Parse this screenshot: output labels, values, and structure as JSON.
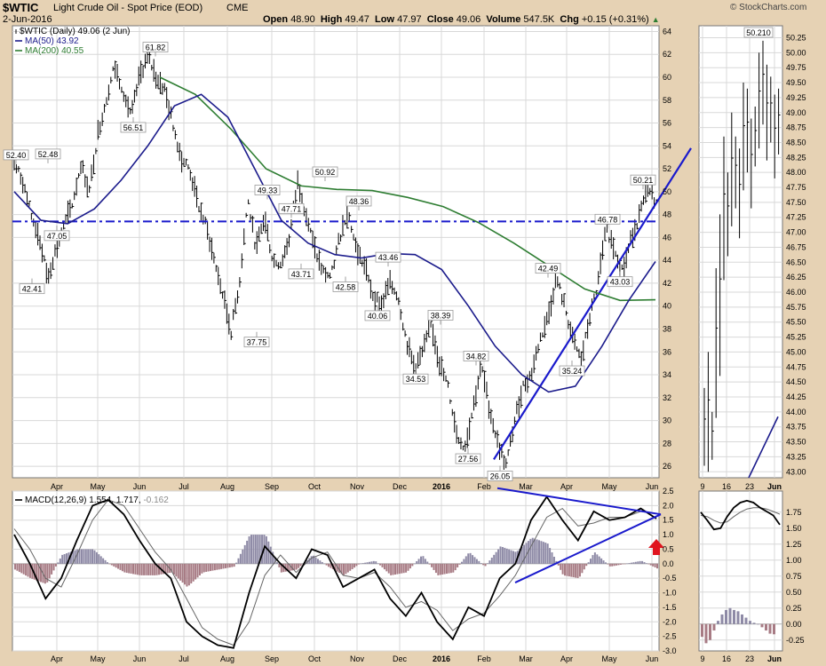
{
  "header": {
    "symbol": "$WTIC",
    "description": "Light Crude Oil - Spot Price (EOD)",
    "exchange": "CME",
    "date": "2-Jun-2016",
    "watermark": "© StockCharts.com",
    "open_label": "Open",
    "open": "48.90",
    "high_label": "High",
    "high": "49.47",
    "low_label": "Low",
    "low": "47.97",
    "close_label": "Close",
    "close": "49.06",
    "volume_label": "Volume",
    "volume": "547.5K",
    "chg_label": "Chg",
    "chg": "+0.15 (+0.31%)"
  },
  "chart_data": [
    {
      "type": "line",
      "title": "$WTIC (Daily) 49.06 (2 Jun)",
      "legend": [
        {
          "name": "$WTIC (Daily) 49.06 (2 Jun)",
          "color": "#000000"
        },
        {
          "name": "MA(50) 43.92",
          "color": "#1c1c8c"
        },
        {
          "name": "MA(200) 40.55",
          "color": "#2e7d32"
        }
      ],
      "x_ticks": [
        "Apr",
        "May",
        "Jun",
        "Jul",
        "Aug",
        "Sep",
        "Oct",
        "Nov",
        "Dec",
        "2016",
        "Feb",
        "Mar",
        "Apr",
        "May",
        "Jun"
      ],
      "y_ticks": [
        26,
        28,
        30,
        32,
        34,
        36,
        38,
        40,
        42,
        44,
        46,
        48,
        50,
        52,
        54,
        56,
        58,
        60,
        62,
        64
      ],
      "ylim": [
        25,
        64.5
      ],
      "price_path": [
        52.4,
        51,
        48,
        46,
        42.41,
        45,
        47.05,
        49,
        52.48,
        50,
        55,
        58,
        61,
        59,
        56.51,
        60,
        61.82,
        60,
        59,
        56,
        53,
        52,
        49,
        47,
        44,
        41,
        37.75,
        42,
        49.33,
        45,
        47.71,
        44,
        43.71,
        46,
        50.92,
        48,
        45,
        43,
        42.58,
        46,
        48.36,
        45,
        43.46,
        41,
        40.06,
        42,
        41,
        37,
        34.53,
        36,
        38.39,
        35,
        33,
        29,
        27.56,
        31,
        34.82,
        31,
        28,
        26.05,
        30,
        33,
        34,
        37,
        39,
        42.49,
        40,
        37,
        35.24,
        39,
        42,
        46.78,
        45,
        43.03,
        46,
        48,
        50.21,
        49.06
      ],
      "swing_labels": [
        {
          "text": "52.40",
          "value": 52.4
        },
        {
          "text": "42.41",
          "value": 42.41
        },
        {
          "text": "47.05",
          "value": 47.05
        },
        {
          "text": "52.48",
          "value": 52.48
        },
        {
          "text": "56.51",
          "value": 56.51
        },
        {
          "text": "61.82",
          "value": 61.82
        },
        {
          "text": "37.75",
          "value": 37.75
        },
        {
          "text": "49.33",
          "value": 49.33
        },
        {
          "text": "47.71",
          "value": 47.71
        },
        {
          "text": "43.71",
          "value": 43.71
        },
        {
          "text": "50.92",
          "value": 50.92
        },
        {
          "text": "42.58",
          "value": 42.58
        },
        {
          "text": "48.36",
          "value": 48.36
        },
        {
          "text": "43.46",
          "value": 43.46
        },
        {
          "text": "40.06",
          "value": 40.06
        },
        {
          "text": "34.53",
          "value": 34.53
        },
        {
          "text": "38.39",
          "value": 38.39
        },
        {
          "text": "27.56",
          "value": 27.56
        },
        {
          "text": "34.82",
          "value": 34.82
        },
        {
          "text": "26.05",
          "value": 26.05
        },
        {
          "text": "35.24",
          "value": 35.24
        },
        {
          "text": "42.49",
          "value": 42.49
        },
        {
          "text": "46.78",
          "value": 46.78
        },
        {
          "text": "43.03",
          "value": 43.03
        },
        {
          "text": "50.21",
          "value": 50.21
        }
      ],
      "ma50": [
        50,
        47.5,
        47.2,
        48.5,
        51,
        54,
        57.5,
        58.5,
        56.5,
        52,
        47.5,
        45.5,
        44.5,
        44.2,
        44.6,
        44.5,
        43.2,
        40,
        36.5,
        34,
        32.5,
        33,
        36.5,
        40.5,
        43.9
      ],
      "ma200": [
        60,
        58.5,
        55.5,
        52,
        50.5,
        50.2,
        50.1,
        49.5,
        48.7,
        47.3,
        45.5,
        43.5,
        41.5,
        40.5,
        40.55
      ],
      "horizontal_level": 47.4,
      "trendline": {
        "from": 26.6,
        "to": 53.8
      },
      "zoom_panel": {
        "x_ticks": [
          "9",
          "16",
          "23",
          "Jun"
        ],
        "y_ticks": [
          43.0,
          43.25,
          43.5,
          43.75,
          44.0,
          44.25,
          44.5,
          44.75,
          45.0,
          45.25,
          45.5,
          45.75,
          46.0,
          46.25,
          46.5,
          46.75,
          47.0,
          47.25,
          47.5,
          47.75,
          48.0,
          48.25,
          48.5,
          48.75,
          49.0,
          49.25,
          49.5,
          49.75,
          50.0,
          50.25
        ],
        "ylim": [
          42.9,
          50.45
        ],
        "high_label": "50.210"
      }
    },
    {
      "type": "line",
      "title": "MACD(12,26,9) 1.554, 1.717, -0.162",
      "legend_title": "MACD(12,26,9)",
      "legend_values": "1.554, 1.717, -0.162",
      "legend_colors": [
        "#000000",
        "#000000",
        "#8a8a8a"
      ],
      "ylim": [
        -3.0,
        2.5
      ],
      "y_ticks": [
        "2.5",
        "2.0",
        "1.5",
        "1.0",
        "0.5",
        "0.0",
        "-0.5",
        "-1.0",
        "-1.5",
        "-2.0",
        "-2.5",
        "-3.0"
      ],
      "x_ticks": [
        "Apr",
        "May",
        "Jun",
        "Jul",
        "Aug",
        "Sep",
        "Oct",
        "Nov",
        "Dec",
        "2016",
        "Feb",
        "Mar",
        "Apr",
        "May",
        "Jun"
      ],
      "macd": [
        1.0,
        0,
        -1.2,
        -0.5,
        0.8,
        2.0,
        2.2,
        1.7,
        0.8,
        0.0,
        -0.5,
        -2.0,
        -2.5,
        -2.8,
        -2.9,
        -1.0,
        0.6,
        0.0,
        -0.5,
        0.5,
        0.3,
        -0.8,
        -0.5,
        -0.2,
        -1.2,
        -1.8,
        -1.0,
        -2.0,
        -2.6,
        -1.5,
        -1.8,
        -0.5,
        0.0,
        1.5,
        2.3,
        1.5,
        0.8,
        1.8,
        1.5,
        1.6,
        1.9,
        1.554
      ],
      "signal": [
        1.2,
        0.5,
        -0.5,
        -0.8,
        0.3,
        1.5,
        2.2,
        2.0,
        1.2,
        0.4,
        -0.2,
        -1.2,
        -2.2,
        -2.6,
        -2.8,
        -2.0,
        -0.4,
        0.3,
        -0.3,
        0.2,
        0.4,
        -0.4,
        -0.5,
        -0.3,
        -0.8,
        -1.5,
        -1.3,
        -1.6,
        -2.3,
        -1.9,
        -1.7,
        -1.1,
        -0.4,
        0.6,
        1.6,
        1.9,
        1.3,
        1.4,
        1.6,
        1.6,
        1.8,
        1.717
      ],
      "histogram": [
        -0.2,
        -0.5,
        -0.7,
        0.3,
        0.5,
        0.5,
        0.0,
        -0.3,
        -0.4,
        -0.4,
        -0.3,
        -0.8,
        -0.3,
        -0.2,
        -0.1,
        1.0,
        1.0,
        -0.3,
        -0.2,
        0.3,
        -0.1,
        -0.4,
        0.0,
        0.1,
        -0.4,
        -0.3,
        0.3,
        -0.4,
        -0.3,
        0.4,
        -0.1,
        0.6,
        0.4,
        0.9,
        0.7,
        -0.4,
        -0.5,
        0.4,
        -0.1,
        0.0,
        0.1,
        -0.162
      ],
      "zoom_panel": {
        "y_ticks": [
          "1.75",
          "1.50",
          "1.25",
          "1.00",
          "0.75",
          "0.50",
          "0.25",
          "0.00",
          "-0.25"
        ],
        "ylim": [
          -0.42,
          2.08
        ],
        "x_ticks": [
          "9",
          "16",
          "23",
          "Jun"
        ]
      }
    }
  ],
  "colors": {
    "frame": "#e6d2b4",
    "plot_bg": "#ffffff",
    "grid": "#d8d8d8",
    "price_bars": "#000000",
    "ma50": "#1c1c8c",
    "ma200": "#2e7d32",
    "trendline": "#1a1acc",
    "hist_positive": "#8e8aa6",
    "hist_negative": "#a77b84",
    "arrow": "#e0141e"
  }
}
